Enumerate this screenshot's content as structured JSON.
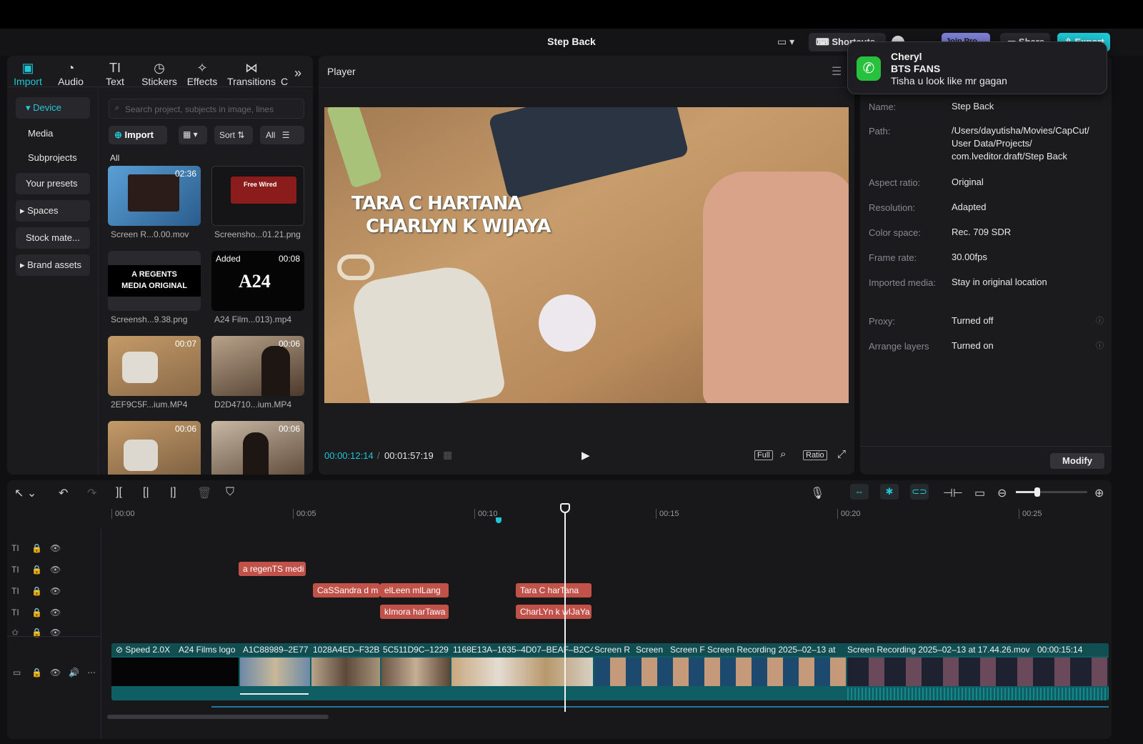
{
  "window": {
    "title": "Step Back"
  },
  "toolbar": {
    "shortcuts_label": "Shortcuts",
    "join_pro_label": "Join Pro",
    "share_label": "Share",
    "export_label": "Export"
  },
  "notification": {
    "app_icon": "whatsapp-icon",
    "sender": "Cheryl",
    "group": "BTS FANS",
    "message": "Tisha u look like mr gagan"
  },
  "media_tabs": [
    {
      "label": "Import",
      "icon": "import-icon",
      "active": true
    },
    {
      "label": "Audio",
      "icon": "audio-icon"
    },
    {
      "label": "Text",
      "icon": "text-icon"
    },
    {
      "label": "Stickers",
      "icon": "stickers-icon"
    },
    {
      "label": "Effects",
      "icon": "effects-icon"
    },
    {
      "label": "Transitions",
      "icon": "transitions-icon"
    },
    {
      "label": "C",
      "icon": ""
    }
  ],
  "sidebar": {
    "items": [
      {
        "label": "Device"
      },
      {
        "label": "Media"
      },
      {
        "label": "Subprojects"
      },
      {
        "label": "Your presets"
      },
      {
        "label": "Spaces"
      },
      {
        "label": "Stock mate..."
      },
      {
        "label": "Brand assets"
      }
    ]
  },
  "media": {
    "search_placeholder": "Search project, subjects in image, lines",
    "import_label": "Import",
    "sort_label": "Sort",
    "filter_label": "All",
    "section_label": "All",
    "items": [
      {
        "name": "Screen R...0.00.mov",
        "duration": "02:36",
        "added": ""
      },
      {
        "name": "Screensho...01.21.png",
        "duration": "",
        "added": ""
      },
      {
        "name": "Screensh...9.38.png",
        "duration": "",
        "added": ""
      },
      {
        "name": "A24 Film...013).mp4",
        "duration": "00:08",
        "added": "Added"
      },
      {
        "name": "2EF9C5F...ium.MP4",
        "duration": "00:07",
        "added": ""
      },
      {
        "name": "D2D4710...ium.MP4",
        "duration": "00:06",
        "added": ""
      },
      {
        "name": "",
        "duration": "00:06",
        "added": ""
      },
      {
        "name": "",
        "duration": "00:06",
        "added": ""
      }
    ],
    "thumb_texts": {
      "free_wired": "Free Wired",
      "regents": "A REGENTS MEDIA ORIGINAL",
      "a24": "A24"
    }
  },
  "player": {
    "title": "Player",
    "overlay_line1": "TARA C HARTANA",
    "overlay_line2": "CHARLYN K WIJAYA",
    "current_time": "00:00:12:14",
    "total_time": "00:01:57:19",
    "full_label": "Full",
    "ratio_label": "Ratio"
  },
  "details": {
    "rows": [
      {
        "label": "Name:",
        "value": "Step Back"
      },
      {
        "label": "Path:",
        "value": "/Users/dayutisha/Movies/CapCut/ User Data/Projects/ com.lveditor.draft/Step Back"
      },
      {
        "label": "Aspect ratio:",
        "value": "Original"
      },
      {
        "label": "Resolution:",
        "value": "Adapted"
      },
      {
        "label": "Color space:",
        "value": "Rec. 709 SDR"
      },
      {
        "label": "Frame rate:",
        "value": "30.00fps"
      },
      {
        "label": "Imported media:",
        "value": "Stay in original location"
      },
      {
        "label": "Proxy:",
        "value": "Turned off"
      },
      {
        "label": "Arrange layers",
        "value": "Turned on"
      }
    ],
    "modify_label": "Modify"
  },
  "timeline": {
    "ticks": [
      "00:00",
      "00:05",
      "00:10",
      "00:15",
      "00:20",
      "00:25"
    ],
    "text_clips": [
      {
        "label": "a regenTS medi"
      },
      {
        "label": "CaSSandra d m"
      },
      {
        "label": "elLeen mlLang"
      },
      {
        "label": "Tara C harTana"
      },
      {
        "label": "kImora harTawa"
      },
      {
        "label": "CharLYn k wIJaYa"
      }
    ],
    "video_segments": [
      "Speed 2.0X",
      "A24 Films logo",
      "A1C88989–2E77",
      "1028A4ED–F32B",
      "5C511D9C–1229",
      "1168E13A–1635–4D07–BEAF–B2C4",
      "Screen R",
      "Screen",
      "Screen F",
      "Screen Recording 2025–02–13 at",
      "Screen Recording 2025–02–13 at 17.44.26.mov",
      "00:00:15:14"
    ],
    "accent": "#1fc6d6",
    "text_clip_color": "#c0524a",
    "video_track_color": "#0f5e63"
  }
}
